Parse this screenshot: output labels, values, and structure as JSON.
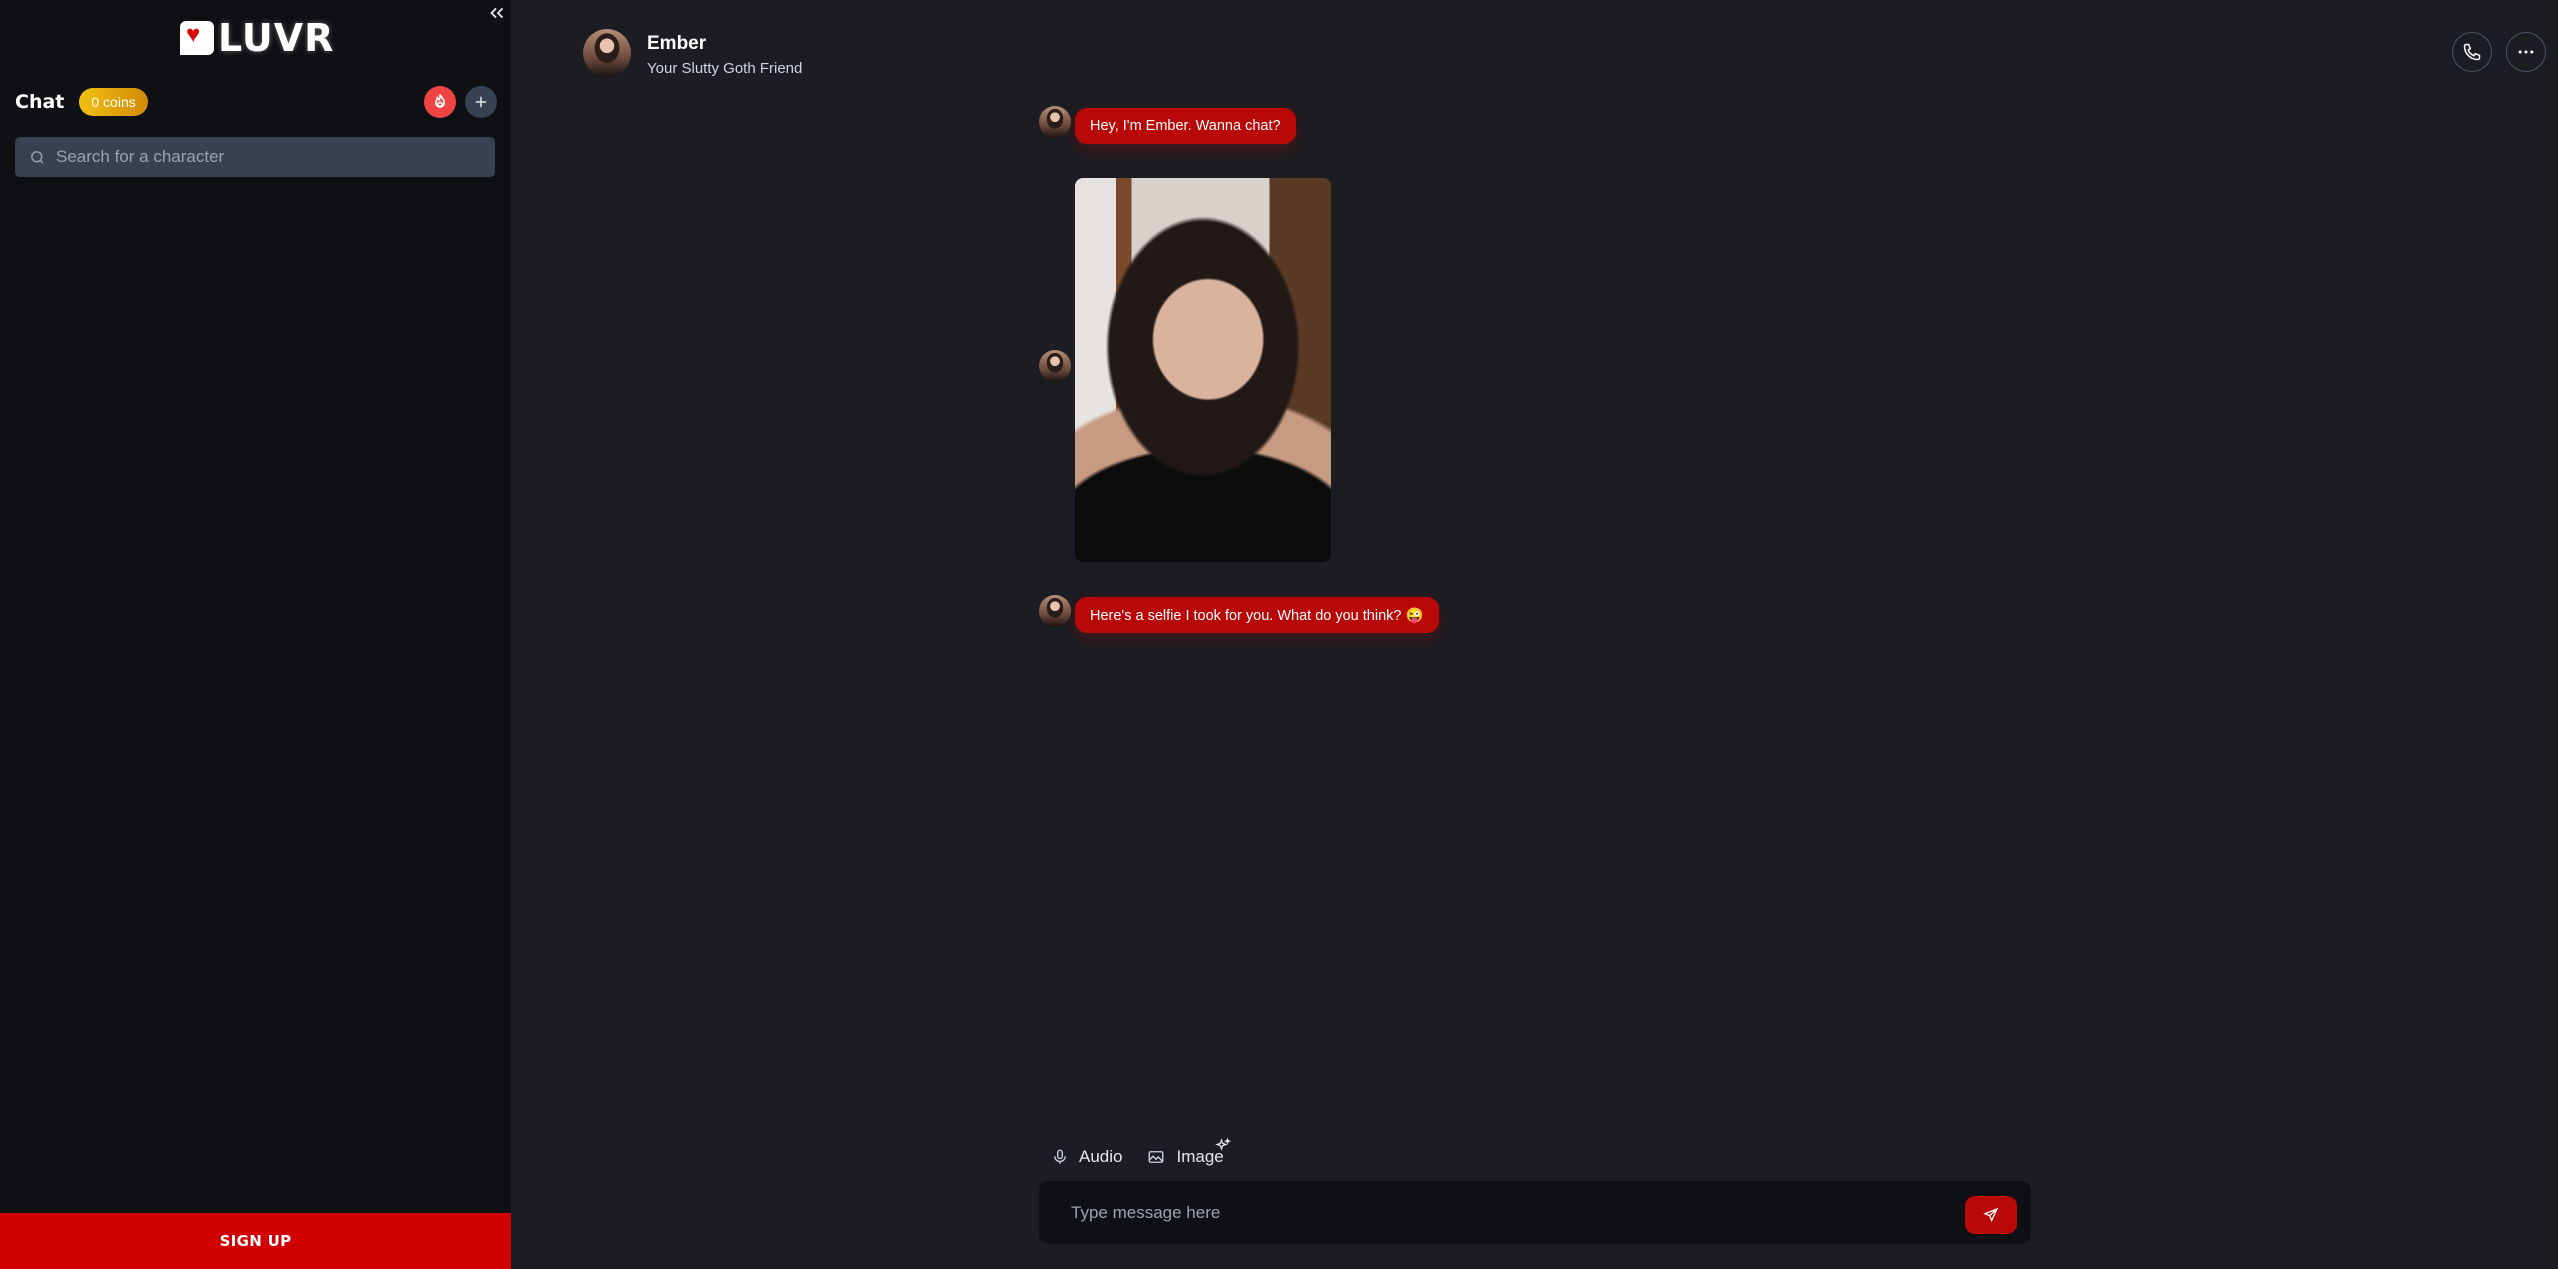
{
  "sidebar": {
    "logo_text": "LUVR",
    "chat_label": "Chat",
    "coins_badge": "0 coins",
    "search": {
      "placeholder": "Search for a character",
      "value": ""
    },
    "signup_label": "SIGN UP"
  },
  "header": {
    "character_name": "Ember",
    "character_subtitle": "Your Slutty Goth Friend"
  },
  "messages": [
    {
      "sender": "Ember",
      "type": "text",
      "text": "Hey, I'm Ember. Wanna chat?"
    },
    {
      "sender": "Ember",
      "type": "image",
      "alt": "selfie photo"
    },
    {
      "sender": "Ember",
      "type": "text",
      "text": "Here's a selfie I took for you. What do you think? 😜"
    }
  ],
  "composer": {
    "audio_label": "Audio",
    "image_label": "Image",
    "placeholder": "Type message here",
    "value": ""
  },
  "colors": {
    "accent": "#b90808",
    "signup": "#d10000",
    "coins": "#f2c012"
  }
}
